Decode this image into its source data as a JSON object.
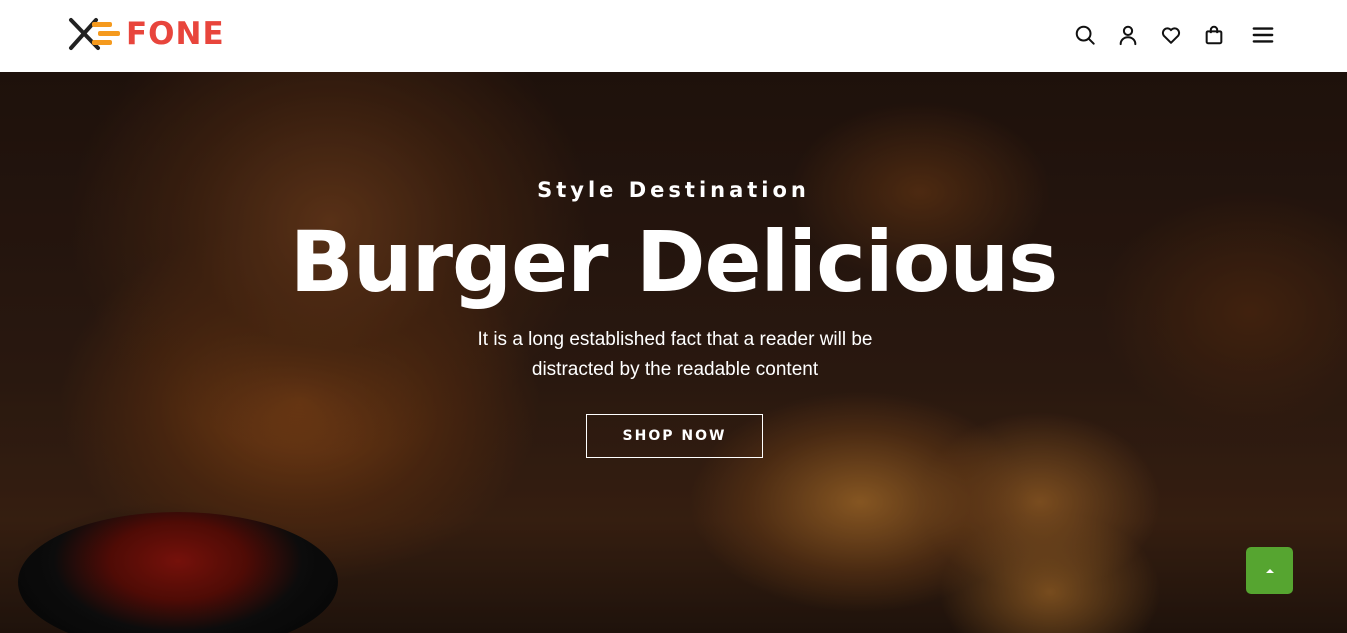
{
  "header": {
    "logo_text": "FONE",
    "icons": [
      "search-icon",
      "user-icon",
      "heart-icon",
      "shopping-bag-icon",
      "menu-icon"
    ]
  },
  "hero": {
    "subtitle": "Style Destination",
    "title": "Burger Delicious",
    "description": "It is a long established fact that a reader will be distracted by the readable content",
    "button_label": "SHOP NOW"
  },
  "colors": {
    "brand": "#e8453c",
    "accent_orange": "#f59a1e",
    "back_to_top": "#56a530"
  }
}
